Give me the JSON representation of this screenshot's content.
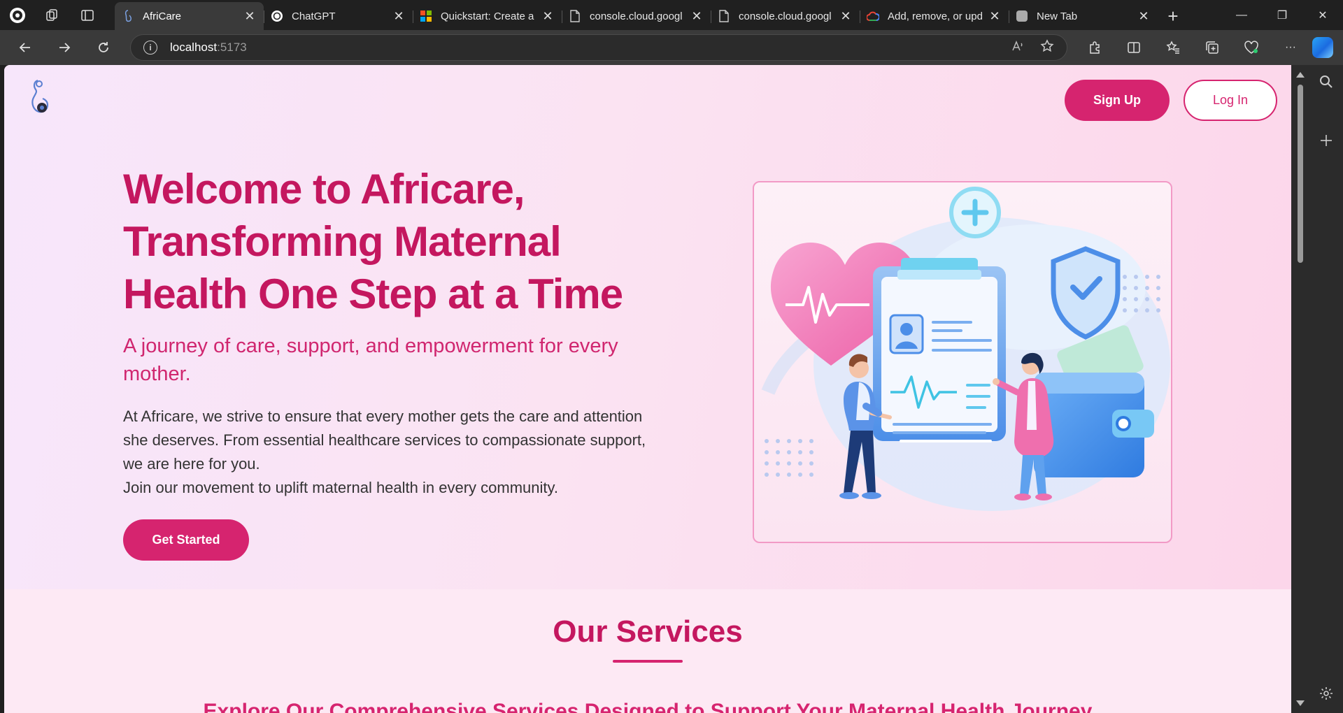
{
  "browser": {
    "tabs": [
      {
        "title": "AfriCare",
        "icon": "africare-favicon",
        "active": true
      },
      {
        "title": "ChatGPT",
        "icon": "chatgpt-favicon",
        "active": false
      },
      {
        "title": "Quickstart: Create a",
        "icon": "microsoft-favicon",
        "active": false
      },
      {
        "title": "console.cloud.googl",
        "icon": "document-favicon",
        "active": false
      },
      {
        "title": "console.cloud.googl",
        "icon": "document-favicon",
        "active": false
      },
      {
        "title": "Add, remove, or upd",
        "icon": "google-cloud-favicon",
        "active": false
      },
      {
        "title": "New Tab",
        "icon": "newtab-favicon",
        "active": false
      }
    ],
    "address": {
      "host": "localhost",
      "port": ":5173"
    }
  },
  "header": {
    "signup_label": "Sign Up",
    "login_label": "Log In"
  },
  "hero": {
    "title": "Welcome to Africare, Transforming Maternal Health One Step at a Time",
    "subtitle": "A journey of care, support, and empowerment for every mother.",
    "body_line1": "At Africare, we strive to ensure that every mother gets the care and attention she deserves. From essential healthcare services to compassionate support, we are here for you.",
    "body_line2": "Join our movement to uplift maternal health in every community.",
    "cta_label": "Get Started"
  },
  "services": {
    "title": "Our Services",
    "subtitle": "Explore Our Comprehensive Services Designed to Support Your Maternal Health Journey"
  },
  "colors": {
    "brand": "#d6246f",
    "heading": "#c4175f",
    "hero_bg": "#fbe3f2"
  }
}
